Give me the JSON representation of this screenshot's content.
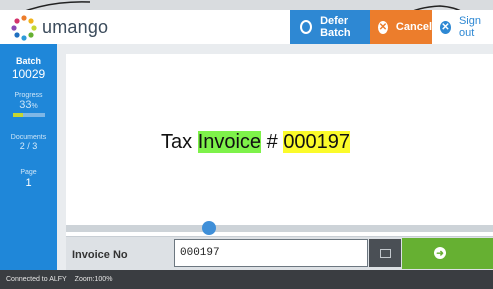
{
  "brand": {
    "name": "umango"
  },
  "header": {
    "defer_label": "Defer Batch",
    "cancel_label": "Cancel",
    "signout_label": "Sign out"
  },
  "sidebar": {
    "batch_label": "Batch",
    "batch_value": "10029",
    "progress_label": "Progress",
    "progress_value": "33",
    "progress_unit": "%",
    "progress_fraction": 0.33,
    "documents_label": "Documents",
    "documents_current": "2",
    "documents_sep": "/",
    "documents_total": "3",
    "page_label": "Page",
    "page_value": "1"
  },
  "document": {
    "prefix": "Tax ",
    "word_highlight": "Invoice",
    "hash": " # ",
    "number_highlight": "000197"
  },
  "field": {
    "label": "Invoice No",
    "value": "000197"
  },
  "status": {
    "connected": "Connected to ALFY",
    "zoom": "Zoom:100%"
  },
  "colors": {
    "accent_blue": "#2e88d3",
    "cancel_orange": "#ec7d2c",
    "go_green": "#66b032",
    "highlight_green": "#7ef24a",
    "highlight_yellow": "#fbfb2a",
    "sidebar_blue": "#1f87d9"
  },
  "icons": {
    "defer": "undo-icon",
    "cancel": "close-icon",
    "signout": "close-icon",
    "field_side": "square-icon",
    "go": "arrow-right-icon"
  }
}
